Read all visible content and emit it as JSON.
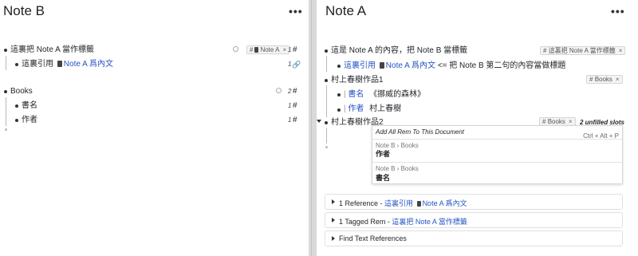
{
  "noteB": {
    "title": "Note B",
    "more": "•••",
    "rem1": {
      "text": "這裏把 Note A 當作標籤",
      "tag_label": "Note A",
      "count": "1"
    },
    "rem1_child": {
      "prefix": "這裏引用",
      "ref_text": "Note A 爲內文",
      "count": "1"
    },
    "books": {
      "text": "Books",
      "count": "2"
    },
    "books_child1": {
      "text": "書名",
      "count": "1"
    },
    "books_child2": {
      "text": "作者",
      "count": "1"
    }
  },
  "noteA": {
    "title": "Note A",
    "more": "•••",
    "rem1": {
      "text": "這是 Note A 的內容，把 Note B 當標籤",
      "tag_label": "這裏把 Note A 當作標籤"
    },
    "rem1_child": {
      "ref_text": "這裏引用",
      "ref_doc": "Note A 爲內文",
      "suffix": "<= 把 Note B 第二句的內容當做標題"
    },
    "work1": {
      "text": "村上春樹作品1",
      "tag_label": "Books"
    },
    "work1_c1": {
      "label": "書名",
      "value": "《挪威的森林》"
    },
    "work1_c2": {
      "label": "作者",
      "value": "村上春樹"
    },
    "work2": {
      "text": "村上春樹作品2",
      "tag_label": "Books",
      "unfilled": "2 unfilled slots"
    },
    "popup": {
      "add_all": "Add All Rem To This Document",
      "shortcut": "Ctrl + Alt + P",
      "item1_path": "Note B › Books",
      "item1_name": "作者",
      "item2_path": "Note B › Books",
      "item2_name": "書名"
    },
    "sections": {
      "references": {
        "label": "1 Reference - ",
        "ref_text": "這裏引用",
        "ref_doc": "Note A 爲內文"
      },
      "tagged": {
        "label": "1 Tagged Rem - ",
        "ref_text": "這裏把 Note A 當作標籤"
      },
      "text_refs": {
        "label": "Find Text References"
      }
    }
  },
  "colors": {
    "ref": "#2555c4",
    "divider": "#d9d9d9"
  },
  "icons": {
    "more": "more-horizontal-icon",
    "doc": "document-icon",
    "link": "link-icon",
    "hash": "hash-icon"
  }
}
